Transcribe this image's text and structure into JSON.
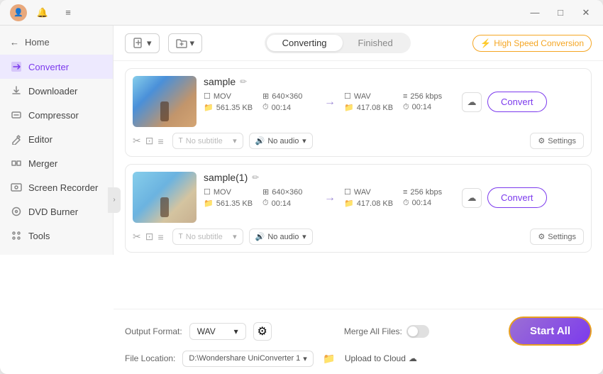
{
  "titlebar": {
    "minimize": "—",
    "maximize": "□",
    "close": "✕"
  },
  "sidebar": {
    "home_label": "Home",
    "items": [
      {
        "id": "converter",
        "label": "Converter",
        "icon": "⬛",
        "active": true
      },
      {
        "id": "downloader",
        "label": "Downloader",
        "icon": "⬛"
      },
      {
        "id": "compressor",
        "label": "Compressor",
        "icon": "⬛"
      },
      {
        "id": "editor",
        "label": "Editor",
        "icon": "⬛"
      },
      {
        "id": "merger",
        "label": "Merger",
        "icon": "⬛"
      },
      {
        "id": "screen-recorder",
        "label": "Screen Recorder",
        "icon": "⬛"
      },
      {
        "id": "dvd-burner",
        "label": "DVD Burner",
        "icon": "⬛"
      },
      {
        "id": "tools",
        "label": "Tools",
        "icon": "⬛"
      }
    ]
  },
  "topbar": {
    "add_file_label": "Add",
    "add_file_dropdown": "▾",
    "add_folder_label": "Add",
    "add_folder_dropdown": "▾",
    "tabs": [
      {
        "id": "converting",
        "label": "Converting",
        "active": true
      },
      {
        "id": "finished",
        "label": "Finished"
      }
    ],
    "speed_badge": "High Speed Conversion"
  },
  "media_items": [
    {
      "id": "sample",
      "name": "sample",
      "source_format": "MOV",
      "source_size": "561.35 KB",
      "source_res": "640×360",
      "source_duration": "00:14",
      "target_format": "WAV",
      "target_size": "417.08 KB",
      "target_bitrate": "256 kbps",
      "target_duration": "00:14",
      "subtitle_placeholder": "No subtitle",
      "audio_label": "No audio",
      "settings_label": "Settings",
      "convert_label": "Convert"
    },
    {
      "id": "sample1",
      "name": "sample(1)",
      "source_format": "MOV",
      "source_size": "561.35 KB",
      "source_res": "640×360",
      "source_duration": "00:14",
      "target_format": "WAV",
      "target_size": "417.08 KB",
      "target_bitrate": "256 kbps",
      "target_duration": "00:14",
      "subtitle_placeholder": "No subtitle",
      "audio_label": "No audio",
      "settings_label": "Settings",
      "convert_label": "Convert"
    }
  ],
  "bottombar": {
    "output_format_label": "Output Format:",
    "output_format_value": "WAV",
    "file_location_label": "File Location:",
    "file_location_value": "D:\\Wondershare UniConverter 1",
    "merge_files_label": "Merge All Files:",
    "upload_cloud_label": "Upload to Cloud",
    "start_all_label": "Start All"
  }
}
